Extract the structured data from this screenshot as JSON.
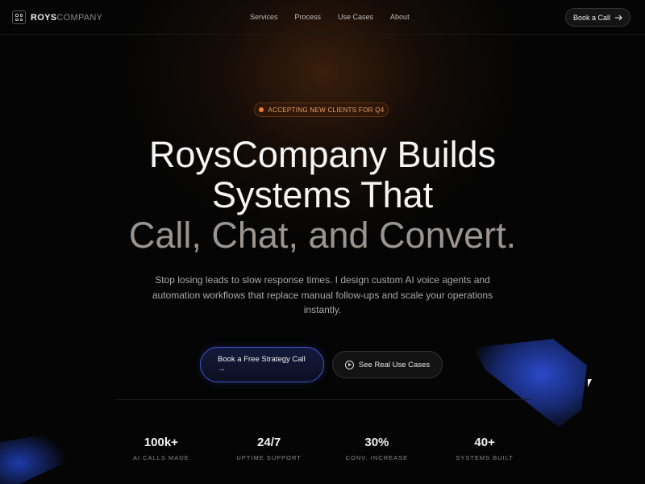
{
  "header": {
    "logo_bold": "ROYS",
    "logo_light": "COMPANY",
    "nav": [
      "Services",
      "Process",
      "Use Cases",
      "About"
    ],
    "cta_label": "Book a Call",
    "cta_icon": "arrow-right-icon"
  },
  "hero": {
    "badge": "ACCEPTING NEW CLIENTS FOR Q4",
    "headline_line1": "RoysCompany Builds",
    "headline_line2": "Systems That",
    "headline_line3": "Call, Chat, and Convert.",
    "subheading": "Stop losing leads to slow response times. I design custom AI voice agents and automation workflows that replace manual follow-ups and scale your operations instantly.",
    "primary_cta": "Book a Free Strategy Call",
    "primary_cta_icon": "→",
    "secondary_cta": "See Real Use Cases",
    "secondary_cta_icon": "play-circle-icon"
  },
  "stats": [
    {
      "value": "100k+",
      "label": "AI CALLS MADE"
    },
    {
      "value": "24/7",
      "label": "UPTIME SUPPORT"
    },
    {
      "value": "30%",
      "label": "CONV. INCREASE"
    },
    {
      "value": "40+",
      "label": "SYSTEMS BUILT"
    }
  ],
  "colors": {
    "accent_orange": "#f07a2c",
    "accent_blue": "#4057d6",
    "background": "#050505"
  }
}
